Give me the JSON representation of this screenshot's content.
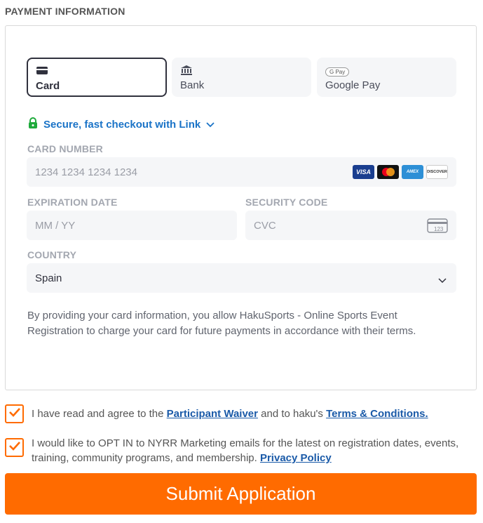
{
  "section_title": "PAYMENT INFORMATION",
  "tabs": [
    {
      "label": "Card",
      "icon": "credit-card-icon"
    },
    {
      "label": "Bank",
      "icon": "bank-icon"
    },
    {
      "label": "Google Pay",
      "icon": "google-pay-icon",
      "icon_text": "G Pay"
    }
  ],
  "link": {
    "text": "Secure, fast checkout with Link",
    "lock_icon": "lock-icon",
    "chevron_icon": "chevron-down-icon"
  },
  "card_number": {
    "label": "CARD NUMBER",
    "placeholder": "1234 1234 1234 1234",
    "brands": [
      "VISA",
      "Mastercard",
      "AMEX",
      "DISCOVER"
    ]
  },
  "expiration": {
    "label": "EXPIRATION DATE",
    "placeholder": "MM / YY"
  },
  "security": {
    "label": "SECURITY CODE",
    "placeholder": "CVC",
    "icon_text": "123"
  },
  "country": {
    "label": "COUNTRY",
    "value": "Spain"
  },
  "disclaimer": "By providing your card information, you allow HakuSports - Online Sports Event Registration to charge your card for future payments in accordance with their terms.",
  "agreements": {
    "waiver": {
      "prefix": "I have read and agree to the ",
      "link1": "Participant Waiver",
      "middle": " and to haku's ",
      "link2": "Terms & Conditions.",
      "checked": true
    },
    "optin": {
      "prefix": "I would like to OPT IN to NYRR Marketing emails for the latest on registration dates, events, training, community programs, and membership. ",
      "link": "Privacy Policy",
      "checked": true
    }
  },
  "submit_label": "Submit Application",
  "colors": {
    "accent": "#ff6b00",
    "link": "#1a73c7",
    "lock": "#1faa3c"
  }
}
